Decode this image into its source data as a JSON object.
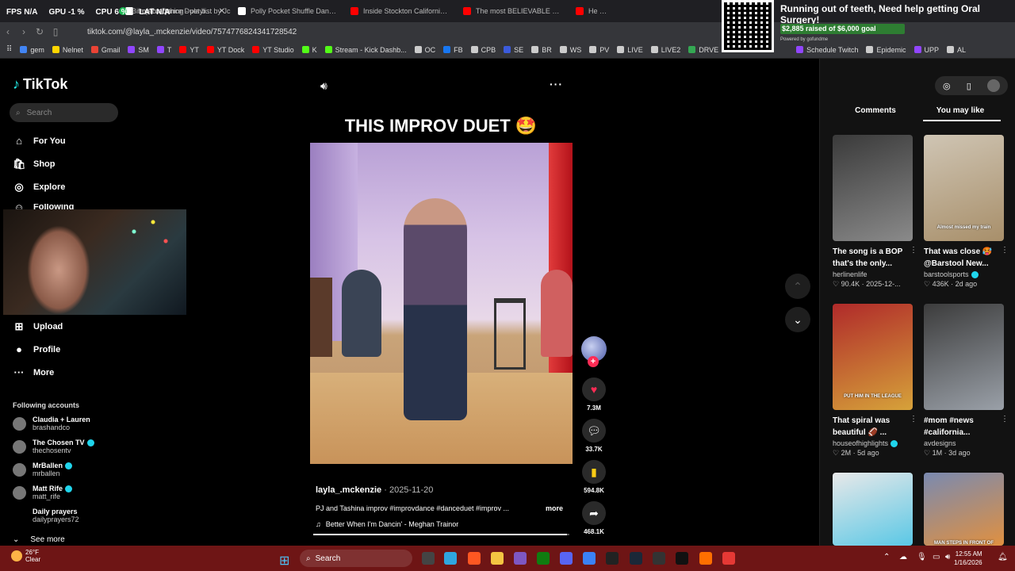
{
  "overlay_stats": {
    "fps_label": "FPS",
    "fps": "N/A",
    "gpu_label": "GPU",
    "gpu": "-1 %",
    "cpu_label": "CPU",
    "cpu": "6 %",
    "lat_label": "LAT",
    "lat": "N/A"
  },
  "tabs": [
    {
      "title": "Bit of Everything - playlist by Jc",
      "color": "#1db954"
    },
    {
      "title": "Improv Dance Duet by PJ",
      "color": "#ffffff",
      "active": true
    },
    {
      "title": "Polly Pocket Shuffle Dance Tuto",
      "color": "#ffffff"
    },
    {
      "title": "Inside Stockton California's Mo",
      "color": "#ff0000"
    },
    {
      "title": "The most BELIEVABLE alien enc",
      "color": "#ff0000"
    },
    {
      "title": "He Survi",
      "color": "#ff0000"
    }
  ],
  "address": {
    "url": "tiktok.com/@layla_.mckenzie/video/7574776824341728542"
  },
  "bookmarks": [
    {
      "label": "gem",
      "color": "#4285f4"
    },
    {
      "label": "Nelnet",
      "color": "#ffd600"
    },
    {
      "label": "Gmail",
      "color": "#ea4335"
    },
    {
      "label": "SM",
      "color": "#9146ff"
    },
    {
      "label": "T",
      "color": "#9146ff"
    },
    {
      "label": "YT",
      "color": "#ff0000"
    },
    {
      "label": "YT Dock",
      "color": "#ff0000"
    },
    {
      "label": "YT Studio",
      "color": "#ff0000"
    },
    {
      "label": "K",
      "color": "#53fc18"
    },
    {
      "label": "Stream - Kick Dashb...",
      "color": "#53fc18"
    },
    {
      "label": "OC",
      "color": "#cccccc"
    },
    {
      "label": "FB",
      "color": "#1877f2"
    },
    {
      "label": "CPB",
      "color": "#cccccc"
    },
    {
      "label": "SE",
      "color": "#3b5bdb"
    },
    {
      "label": "BR",
      "color": "#cccccc"
    },
    {
      "label": "WS",
      "color": "#cccccc"
    },
    {
      "label": "PV",
      "color": "#cccccc"
    },
    {
      "label": "LIVE",
      "color": "#cccccc"
    },
    {
      "label": "LIVE2",
      "color": "#cccccc"
    },
    {
      "label": "DRVE",
      "color": "#34a853"
    },
    {
      "label": "Schedule Twitch",
      "color": "#9146ff"
    },
    {
      "label": "Epidemic",
      "color": "#cccccc"
    },
    {
      "label": "UPP",
      "color": "#9146ff"
    },
    {
      "label": "AL",
      "color": "#cccccc"
    }
  ],
  "donation": {
    "title": "Running out of teeth, Need help getting Oral Surgery!",
    "raised": "$2,885 raised of $6,000 goal",
    "progress": 0.48,
    "powered": "Powered by gofundme"
  },
  "sidebar": {
    "logo": "TikTok",
    "search_placeholder": "Search",
    "nav": [
      {
        "label": "For You",
        "icon": "home-icon"
      },
      {
        "label": "Shop",
        "icon": "shop-icon"
      },
      {
        "label": "Explore",
        "icon": "compass-icon"
      },
      {
        "label": "Following",
        "icon": "following-icon"
      },
      {
        "label": "Upload",
        "icon": "upload-icon"
      },
      {
        "label": "Profile",
        "icon": "profile-icon"
      },
      {
        "label": "More",
        "icon": "more-icon"
      }
    ],
    "following_header": "Following accounts",
    "accounts": [
      {
        "name": "Claudia + Lauren",
        "handle": "brashandco",
        "verified": false
      },
      {
        "name": "The Chosen TV",
        "handle": "thechosentv",
        "verified": true
      },
      {
        "name": "MrBallen",
        "handle": "mrballen",
        "verified": true
      },
      {
        "name": "Matt Rife",
        "handle": "matt_rife",
        "verified": true
      },
      {
        "name": "Daily prayers",
        "handle": "dailyprayers72",
        "verified": false
      }
    ],
    "see_more": "See more"
  },
  "video": {
    "title": "THIS IMPROV DUET 🤩",
    "author": "layla_.mckenzie",
    "date": "2025-11-20",
    "separator": " · ",
    "description": "PJ and Tashina improv #improvdance #danceduet #improv ...",
    "more": "more",
    "music": "Better When I'm Dancin' - Meghan Trainor",
    "progress": 0.99
  },
  "actions": {
    "likes": "7.3M",
    "comments": "33.7K",
    "saves": "594.8K",
    "shares": "468.1K"
  },
  "right_panel": {
    "tabs": [
      "Comments",
      "You may like"
    ],
    "active_tab": "You may like",
    "cards": [
      {
        "title": "The song is a BOP that's the only...",
        "user": "herlinenlife",
        "verified": false,
        "likes": "90.4K",
        "age": "2025-12-...",
        "thumb": "#3a3a3a",
        "thumb2": "#8a8a8a"
      },
      {
        "title": "That was close 🥵 @Barstool New...",
        "user": "barstoolsports",
        "verified": true,
        "likes": "436K",
        "age": "2d ago",
        "thumb": "#cfc5b4",
        "thumb2": "#a88f6a",
        "overlay": "Almost missed my train"
      },
      {
        "title": "That spiral was beautiful 🏈 ...",
        "user": "houseofhighlights",
        "verified": true,
        "likes": "2M",
        "age": "5d ago",
        "thumb": "#b02a2a",
        "thumb2": "#d6a23a",
        "overlay": "PUT HIM IN THE LEAGUE"
      },
      {
        "title": "#mom #news #california...",
        "user": "avdesigns",
        "verified": false,
        "likes": "1M",
        "age": "3d ago",
        "thumb": "#3c3c3c",
        "thumb2": "#9aa0a8"
      },
      {
        "title": "",
        "user": "",
        "likes": "",
        "age": "",
        "thumb": "#e8e8e8",
        "thumb2": "#5ac8e6"
      },
      {
        "title": "",
        "user": "",
        "likes": "",
        "age": "",
        "thumb": "#7a8ab0",
        "thumb2": "#e09040",
        "overlay": "MAN STEPS IN FRONT OF"
      }
    ]
  },
  "taskbar": {
    "temp": "26°F",
    "condition": "Clear",
    "search": "Search",
    "time": "12:55 AM",
    "date": "1/16/2026"
  }
}
